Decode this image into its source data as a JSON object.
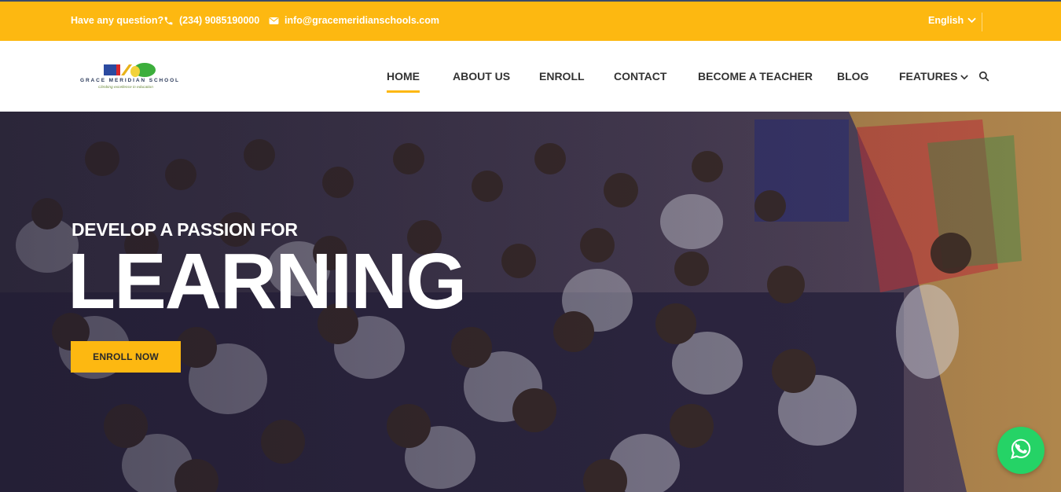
{
  "topbar": {
    "question": "Have any question?",
    "phone": "(234) 9085190000",
    "email": "info@gracemeridianschools.com",
    "language": "English",
    "icons": {
      "phone": "phone-icon",
      "email": "envelope-icon",
      "language": "chevron-down-icon"
    }
  },
  "logo": {
    "brand": "GRACE MERIDIAN SCHOOL",
    "tagline": "Climbing excellence in education"
  },
  "nav": {
    "items": [
      {
        "label": "HOME",
        "active": true
      },
      {
        "label": "ABOUT US",
        "active": false
      },
      {
        "label": "ENROLL",
        "active": false
      },
      {
        "label": "CONTACT",
        "active": false
      },
      {
        "label": "BECOME A TEACHER",
        "active": false
      },
      {
        "label": "BLOG",
        "active": false
      },
      {
        "label": "FEATURES",
        "active": false
      }
    ],
    "icons": {
      "features": "chevron-down-icon",
      "search": "search-icon"
    }
  },
  "hero": {
    "subtitle": "DEVELOP A PASSION FOR",
    "title": "LEARNING",
    "cta": "ENROLL NOW"
  },
  "floating": {
    "icon": "whatsapp-icon"
  },
  "colors": {
    "accent": "#fdb811",
    "text_dark": "#333333",
    "whatsapp": "#25d366"
  }
}
